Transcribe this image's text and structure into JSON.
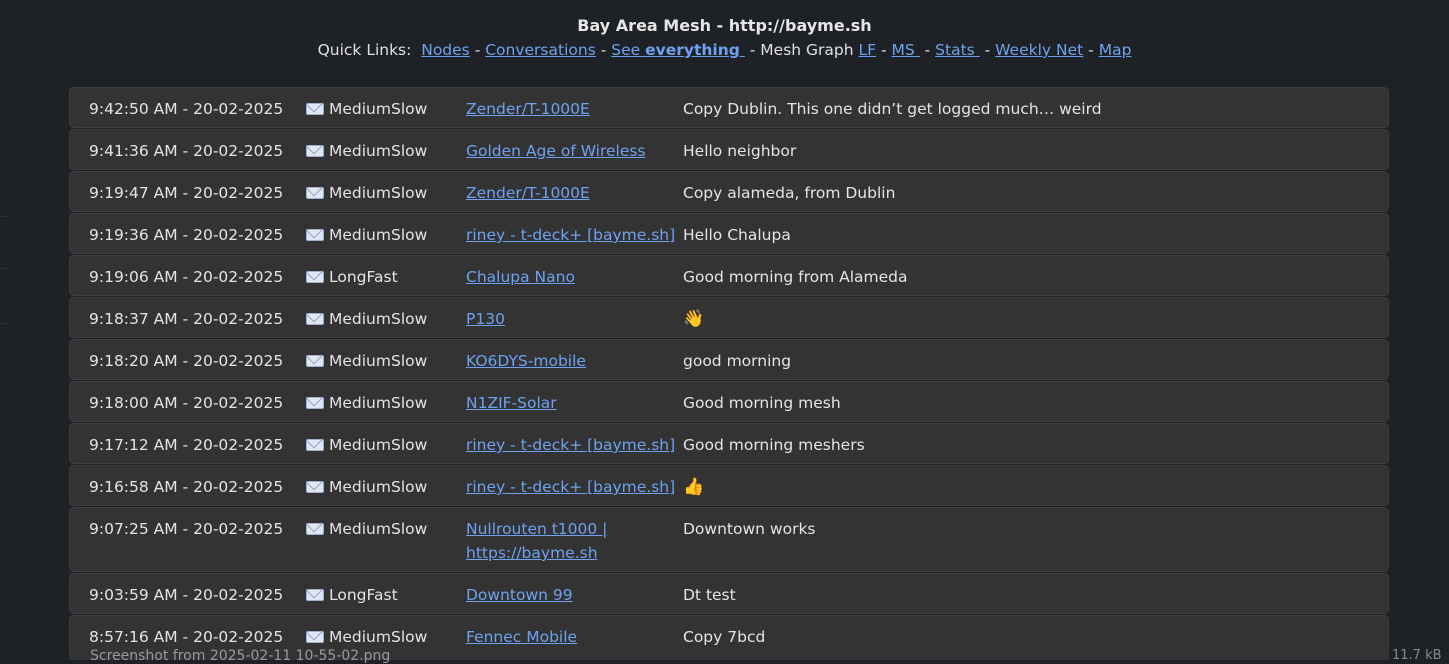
{
  "header": {
    "title": "Bay Area Mesh - http://bayme.sh",
    "quick_links_label": "Quick Links:",
    "links": {
      "nodes": "Nodes",
      "conversations": "Conversations",
      "see_prefix": "See",
      "see_bold": "everything",
      "mesh_graph_label": "Mesh Graph",
      "lf": "LF",
      "ms": "MS",
      "stats": "Stats",
      "weekly_net": "Weekly Net",
      "map": "Map"
    },
    "separator": "-"
  },
  "messages": [
    {
      "time": "9:42:50 AM - 20-02-2025",
      "channel": "MediumSlow",
      "node": "Zender/T-1000E",
      "text": "Copy Dublin. This one didn’t get logged much… weird"
    },
    {
      "time": "9:41:36 AM - 20-02-2025",
      "channel": "MediumSlow",
      "node": "Golden Age of Wireless",
      "text": "Hello neighbor"
    },
    {
      "time": "9:19:47 AM - 20-02-2025",
      "channel": "MediumSlow",
      "node": "Zender/T-1000E",
      "text": "Copy alameda, from Dublin"
    },
    {
      "time": "9:19:36 AM - 20-02-2025",
      "channel": "MediumSlow",
      "node": "riney - t-deck+ [bayme.sh]",
      "text": "Hello Chalupa"
    },
    {
      "time": "9:19:06 AM - 20-02-2025",
      "channel": "LongFast",
      "node": "Chalupa Nano",
      "text": "Good morning from Alameda"
    },
    {
      "time": "9:18:37 AM - 20-02-2025",
      "channel": "MediumSlow",
      "node": "P130",
      "text": "👋"
    },
    {
      "time": "9:18:20 AM - 20-02-2025",
      "channel": "MediumSlow",
      "node": "KO6DYS-mobile",
      "text": "good morning"
    },
    {
      "time": "9:18:00 AM - 20-02-2025",
      "channel": "MediumSlow",
      "node": "N1ZIF-Solar",
      "text": "Good morning mesh"
    },
    {
      "time": "9:17:12 AM - 20-02-2025",
      "channel": "MediumSlow",
      "node": "riney - t-deck+ [bayme.sh]",
      "text": "Good morning meshers"
    },
    {
      "time": "9:16:58 AM - 20-02-2025",
      "channel": "MediumSlow",
      "node": "riney - t-deck+ [bayme.sh]",
      "text": "👍"
    },
    {
      "time": "9:07:25 AM - 20-02-2025",
      "channel": "MediumSlow",
      "node": "Nullrouten t1000 | https://bayme.sh",
      "text": "Downtown works"
    },
    {
      "time": "9:03:59 AM - 20-02-2025",
      "channel": "LongFast",
      "node": "Downtown 99",
      "text": "Dt test"
    },
    {
      "time": "8:57:16 AM - 20-02-2025",
      "channel": "MediumSlow",
      "node": "Fennec Mobile",
      "text": "Copy 7bcd"
    }
  ],
  "channel_icon": "envelope-icon",
  "footer_overlay": {
    "filename": "Screenshot from 2025-02-11 10-55-02.png",
    "size": "11.7 kB"
  },
  "colors": {
    "background": "#1e2125",
    "row_background": "#333333",
    "link": "#6ea2f0",
    "text": "#e4e4e4"
  }
}
